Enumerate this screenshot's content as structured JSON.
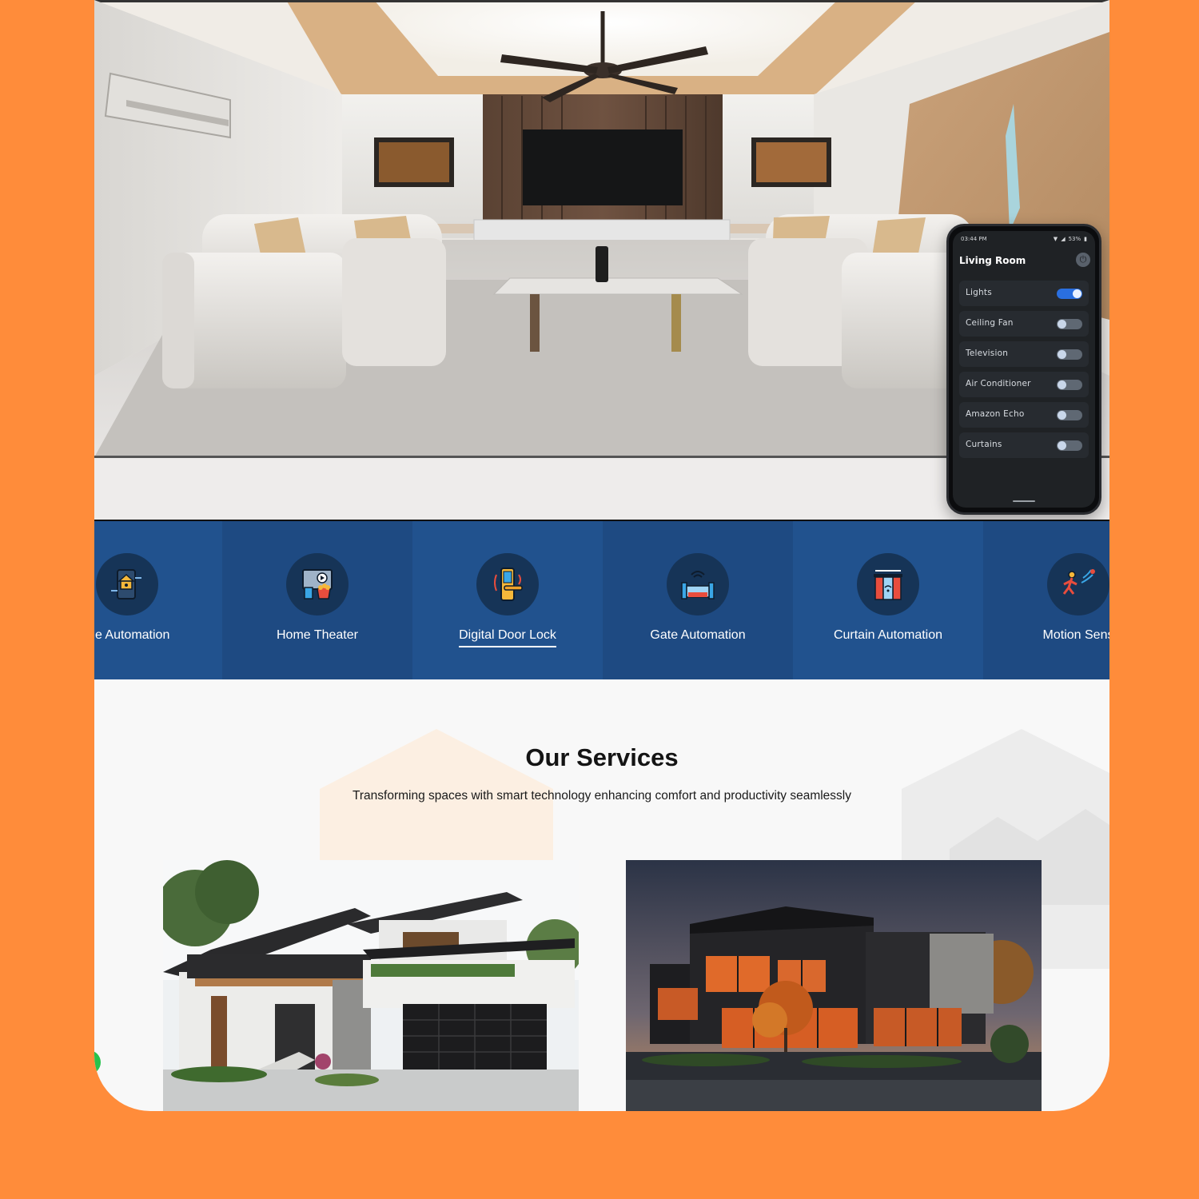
{
  "phone": {
    "status_time": "03:44 PM",
    "battery": "53%",
    "room_title": "Living Room",
    "devices": [
      {
        "label": "Lights",
        "on": true
      },
      {
        "label": "Ceiling Fan",
        "on": false
      },
      {
        "label": "Television",
        "on": false
      },
      {
        "label": "Air Conditioner",
        "on": false
      },
      {
        "label": "Amazon Echo",
        "on": false
      },
      {
        "label": "Curtains",
        "on": false
      }
    ]
  },
  "categories": [
    {
      "label": "me Automation",
      "icon": "smart-home-icon",
      "active": false
    },
    {
      "label": "Home Theater",
      "icon": "home-theater-icon",
      "active": false
    },
    {
      "label": "Digital Door Lock",
      "icon": "door-lock-icon",
      "active": true
    },
    {
      "label": "Gate Automation",
      "icon": "gate-icon",
      "active": false
    },
    {
      "label": "Curtain Automation",
      "icon": "curtain-icon",
      "active": false
    },
    {
      "label": "Motion Sens",
      "icon": "motion-sensor-icon",
      "active": false
    }
  ],
  "services": {
    "title": "Our Services",
    "subtitle": "Transforming spaces with smart technology enhancing comfort and productivity seamlessly"
  },
  "colors": {
    "page_background": "#FF8C3A",
    "strip_blue": "#21528e",
    "strip_blue_dark": "#1e4a82",
    "icon_circle": "#163457",
    "toggle_on": "#2a6fe0"
  }
}
